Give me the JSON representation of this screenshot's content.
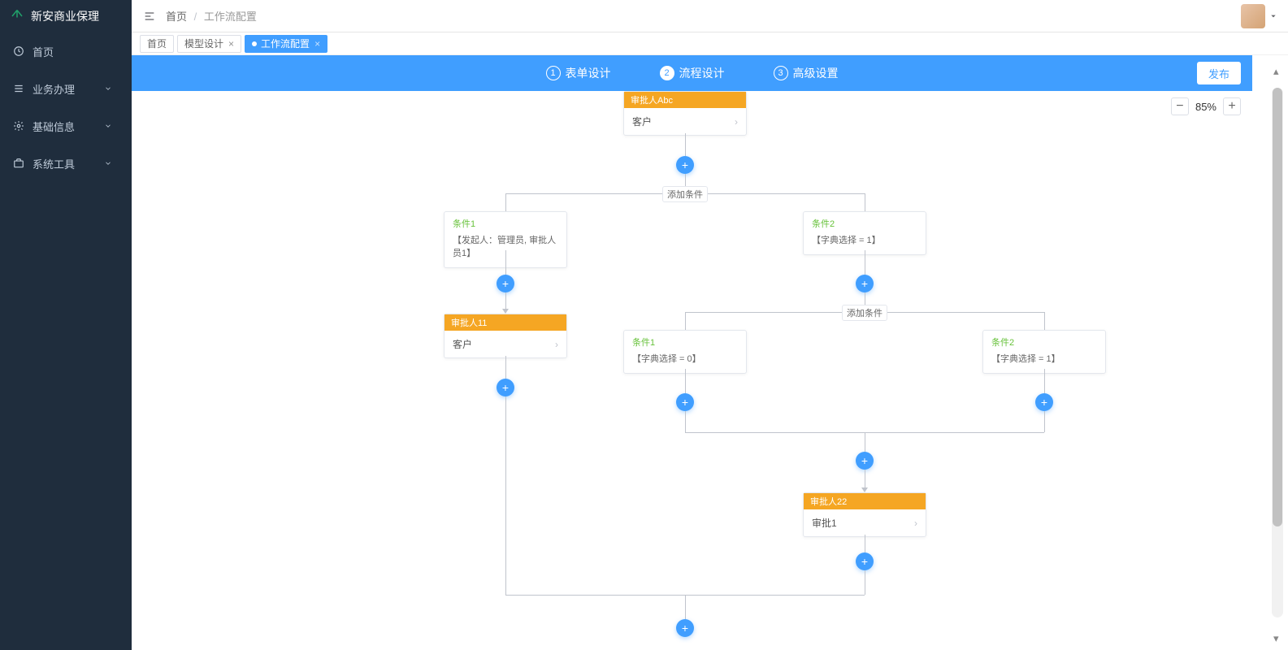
{
  "app": {
    "title": "新安商业保理"
  },
  "sidebar": {
    "items": [
      {
        "label": "首页"
      },
      {
        "label": "业务办理"
      },
      {
        "label": "基础信息"
      },
      {
        "label": "系统工具"
      }
    ]
  },
  "breadcrumb": {
    "root": "首页",
    "current": "工作流配置"
  },
  "tabs": [
    {
      "label": "首页",
      "active": false,
      "closable": false
    },
    {
      "label": "模型设计",
      "active": false,
      "closable": true
    },
    {
      "label": "工作流配置",
      "active": true,
      "closable": true
    }
  ],
  "steps": [
    {
      "num": "1",
      "label": "表单设计"
    },
    {
      "num": "2",
      "label": "流程设计"
    },
    {
      "num": "3",
      "label": "高级设置"
    }
  ],
  "active_step": 2,
  "publish_label": "发布",
  "zoom": {
    "value": "85%"
  },
  "flow": {
    "start": {
      "title": "审批人Abc",
      "body": "客户"
    },
    "add_condition_label": "添加条件",
    "branch1": {
      "cond1": {
        "name": "条件1",
        "expr": "【发起人：管理员, 审批人员1】"
      },
      "cond2": {
        "name": "条件2",
        "expr": "【字典选择 = 1】"
      }
    },
    "left_approver": {
      "title": "审批人11",
      "body": "客户"
    },
    "branch2": {
      "cond1": {
        "name": "条件1",
        "expr": "【字典选择 = 0】"
      },
      "cond2": {
        "name": "条件2",
        "expr": "【字典选择 = 1】"
      }
    },
    "mid_approver": {
      "title": "审批人22",
      "body": "审批1"
    }
  }
}
